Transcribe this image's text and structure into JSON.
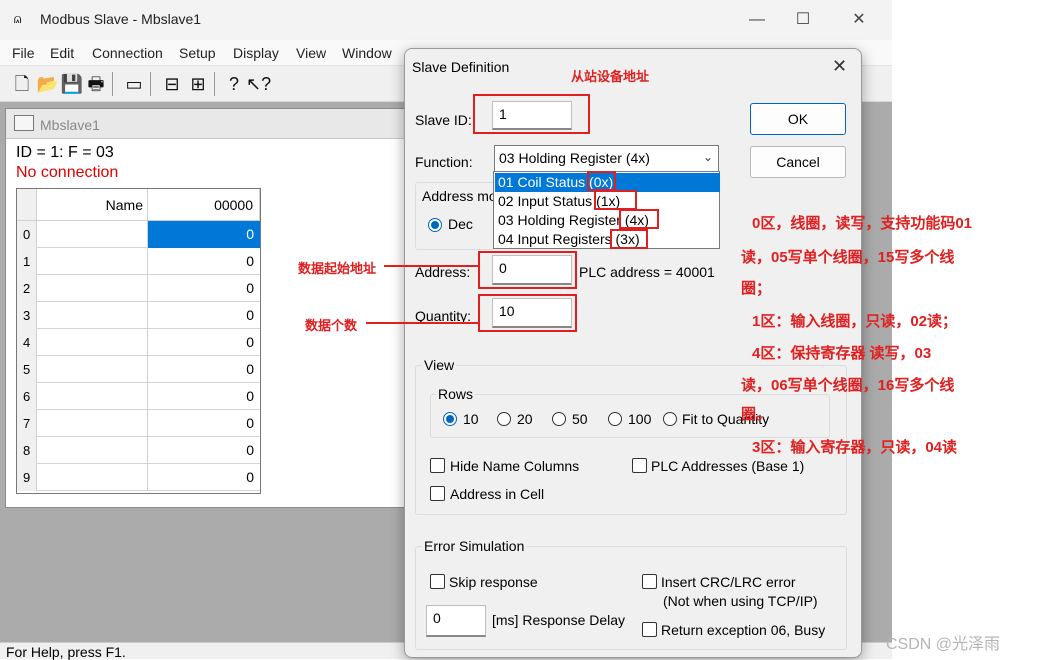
{
  "app": {
    "title": "Modbus Slave - Mbslave1",
    "icon_glyph": "⩄",
    "minimize_glyph": "—",
    "maximize_glyph": "☐",
    "close_glyph": "✕"
  },
  "menu": [
    "File",
    "Edit",
    "Connection",
    "Setup",
    "Display",
    "View",
    "Window"
  ],
  "toolbar": {
    "icons": [
      "new-file-icon",
      "open-folder-icon",
      "save-icon",
      "print-icon",
      "window-icon",
      "connect-icon",
      "disconnect-icon",
      "help-icon",
      "context-help-icon"
    ],
    "glyphs": [
      "🗋",
      "📂",
      "💾",
      "🖶",
      "▭",
      "⊟",
      "⊞",
      "?",
      "↖?"
    ]
  },
  "child": {
    "title": "Mbslave1",
    "info_line": "ID = 1: F = 03",
    "connection_status": "No connection",
    "columns": {
      "name": "Name",
      "address": "00000"
    },
    "rows": [
      {
        "n": "0",
        "value": "0"
      },
      {
        "n": "1",
        "value": "0"
      },
      {
        "n": "2",
        "value": "0"
      },
      {
        "n": "3",
        "value": "0"
      },
      {
        "n": "4",
        "value": "0"
      },
      {
        "n": "5",
        "value": "0"
      },
      {
        "n": "6",
        "value": "0"
      },
      {
        "n": "7",
        "value": "0"
      },
      {
        "n": "8",
        "value": "0"
      },
      {
        "n": "9",
        "value": "0"
      }
    ]
  },
  "statusbar": {
    "text": "For Help, press F1."
  },
  "dialog": {
    "title": "Slave Definition",
    "close_glyph": "✕",
    "slave_id_label": "Slave ID:",
    "slave_id_value": "1",
    "function_label": "Function:",
    "function_value": "03 Holding Register (4x)",
    "function_options": [
      "01 Coil Status (0x)",
      "02 Input Status (1x)",
      "03 Holding Register (4x)",
      "04 Input Registers (3x)"
    ],
    "address_mode_label": "Address mo",
    "address_mode_dec": "Dec",
    "address_label": "Address:",
    "address_value": "0",
    "plc_address": "PLC address = 40001",
    "quantity_label": "Quantity:",
    "quantity_value": "10",
    "ok_label": "OK",
    "cancel_label": "Cancel",
    "view": {
      "label": "View",
      "rows_label": "Rows",
      "row_options": [
        "10",
        "20",
        "50",
        "100",
        "Fit to Quantity"
      ],
      "hide_name_columns": "Hide Name Columns",
      "plc_addresses": "PLC Addresses (Base 1)",
      "address_in_cell": "Address in Cell"
    },
    "error_sim": {
      "label": "Error Simulation",
      "skip_response": "Skip response",
      "insert_crc": "Insert CRC/LRC error",
      "not_tcp": "(Not when using TCP/IP)",
      "delay_value": "0",
      "delay_label": "[ms] Response Delay",
      "return_exception": "Return exception 06, Busy"
    }
  },
  "annotations": {
    "slave_addr": "从站设备地址",
    "start_addr": "数据起始地址",
    "count": "数据个数",
    "note_0x_a": "0区，线圈，读写，支持功能码01",
    "note_0x_b": "读，05写单个线圈，15写多个线",
    "note_0x_c": "圈；",
    "note_1x": "1区：输入线圈，只读，02读；",
    "note_4x_a": "4区：保持寄存器 读写，03",
    "note_4x_b": "读，06写单个线圈，16写多个线",
    "note_4x_c": "圈。",
    "note_3x": "3区：输入寄存器，只读，04读",
    "color": "#e02020"
  },
  "watermark": "CSDN @光泽雨"
}
